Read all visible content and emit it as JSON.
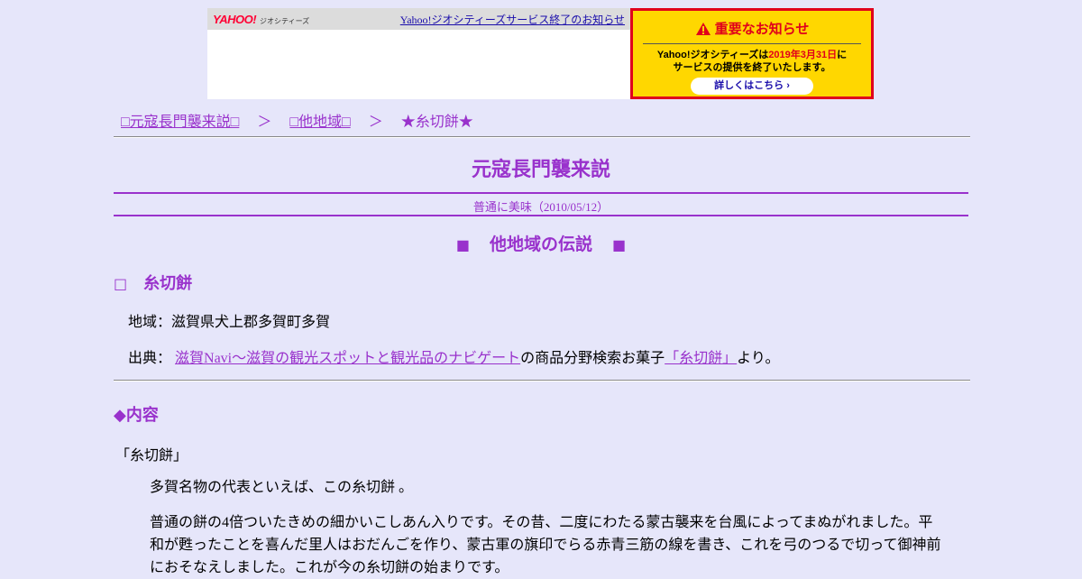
{
  "yahoo_bar": {
    "logo_text": "YAHOO!",
    "logo_sub": "ジオシティーズ",
    "notice_link": "Yahoo!ジオシティーズサービス終了のお知らせ"
  },
  "notice_box": {
    "title": "重要なお知らせ",
    "body_prefix": "Yahoo!ジオシティーズは",
    "body_date": "2019年3月31日",
    "body_suffix": "に",
    "body_line2": "サービスの提供を終了いたします。",
    "button_label": "詳しくはこちら ›"
  },
  "breadcrumb": {
    "items": [
      "□元寇長門襲来説□",
      "□他地域□"
    ],
    "separator": "＞",
    "current": "★糸切餅★"
  },
  "site_title": "元寇長門襲来説",
  "subtitle": "普通に美味（2010/05/12）",
  "section_heading": {
    "left_mark": "■",
    "text": "他地域の伝説",
    "right_mark": "■"
  },
  "item_heading": {
    "box": "□",
    "text": "糸切餅"
  },
  "region": "地域：滋賀県犬上郡多賀町多賀",
  "source": {
    "label": "出典：",
    "link_text": "滋賀Navi～滋賀の観光スポットと観光品のナビゲート",
    "middle": "の商品分野検索お菓子",
    "link2_text": "「糸切餅」",
    "suffix": "より。"
  },
  "content_heading": "◆内容",
  "story_title": "「糸切餅」",
  "paragraphs": [
    "多賀名物の代表といえば、この糸切餅 。",
    "普通の餅の4倍ついたきめの細かいこしあん入りです。その昔、二度にわたる蒙古襲来を台風によってまぬがれました。平和が甦ったことを喜んだ里人はおだんごを作り、蒙古軍の旗印でらる赤青三筋の線を書き、これを弓のつるで切って御神前におそなえしました。これが今の糸切餅の始まりです。"
  ],
  "colors": {
    "background": "#e6e6fa",
    "accent": "#9932cc",
    "notice_yellow": "#ffd700",
    "notice_red": "#e0001b"
  }
}
